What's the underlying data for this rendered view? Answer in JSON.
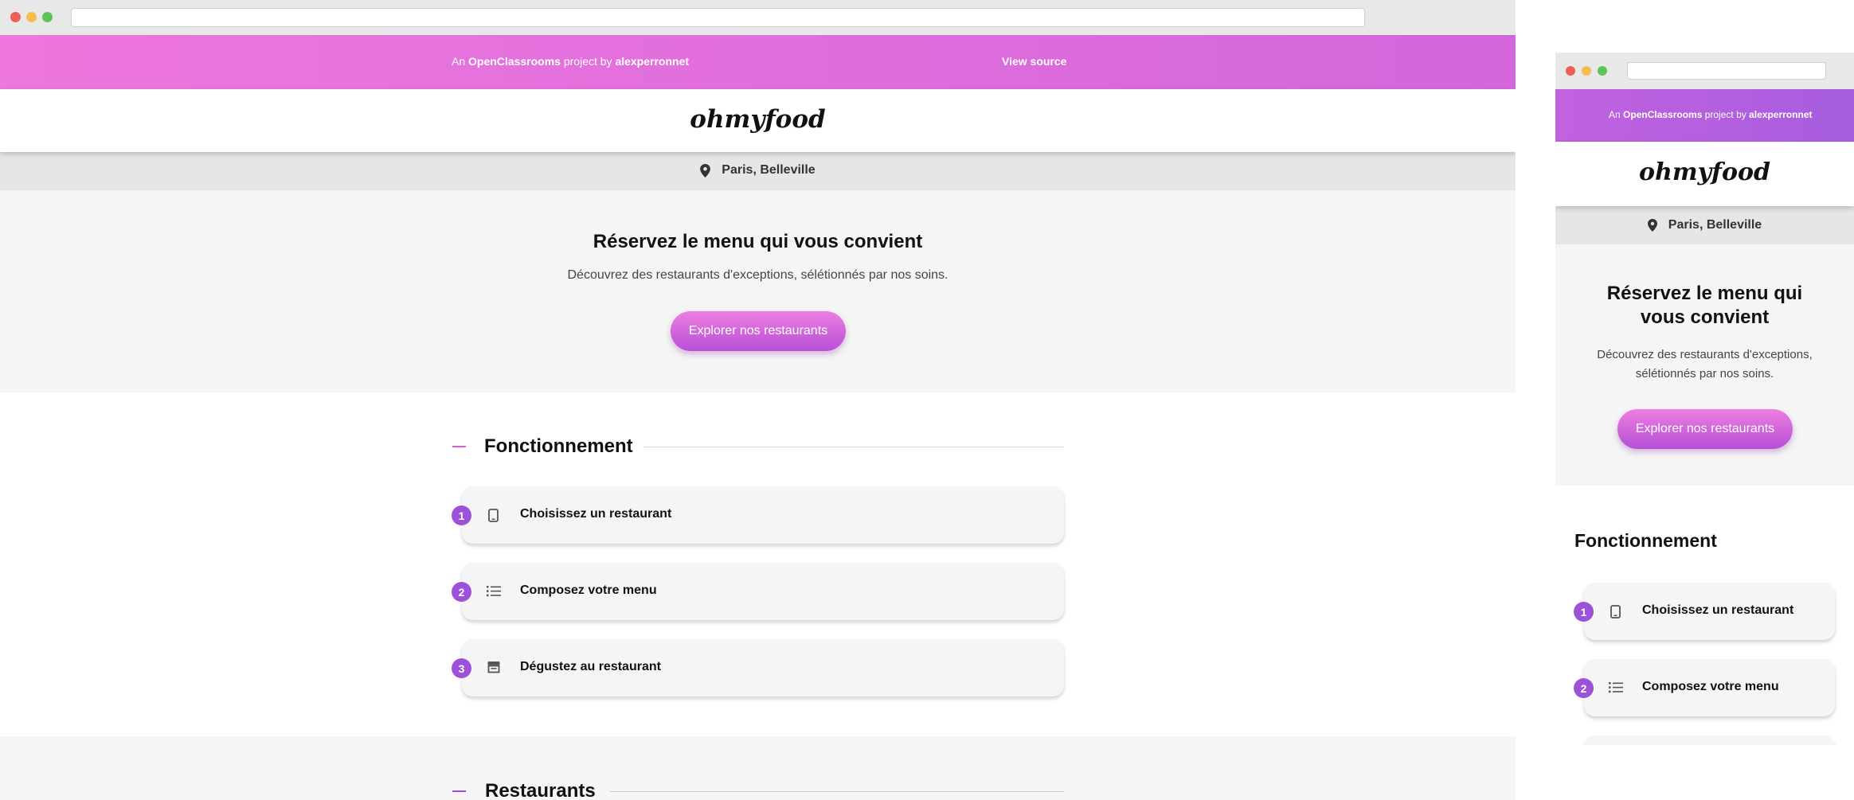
{
  "topbar": {
    "prefix": "An",
    "brand": "OpenClassrooms",
    "middle": "project by",
    "author": "alexperronnet",
    "view_source": "View source"
  },
  "logo": "ohmyfood",
  "location": "Paris, Belleville",
  "hero": {
    "title": "Réservez le menu qui vous convient",
    "subtitle": "Découvrez des restaurants d'exceptions, sélétionnés par nos soins.",
    "cta": "Explorer nos restaurants"
  },
  "sections": {
    "how": "Fonctionnement",
    "restaurants": "Restaurants"
  },
  "steps": [
    {
      "number": "1",
      "label": "Choisissez un restaurant",
      "icon": "phone-icon"
    },
    {
      "number": "2",
      "label": "Composez votre menu",
      "icon": "list-icon"
    },
    {
      "number": "3",
      "label": "Dégustez au restaurant",
      "icon": "store-icon"
    }
  ],
  "colors": {
    "accent_pink": "#ee77dd",
    "accent_purple": "#9b51d8",
    "mobile_topbar": "#c25ee0"
  }
}
